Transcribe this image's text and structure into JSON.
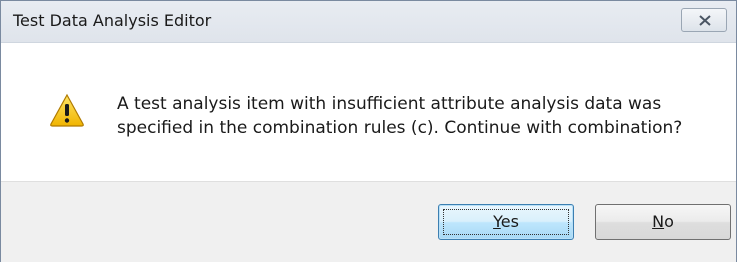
{
  "window": {
    "title": "Test Data Analysis Editor",
    "close_icon": "close-icon"
  },
  "message": {
    "icon": "warning-icon",
    "text": "A test analysis item with insufficient attribute analysis data was specified in the combination rules (c). Continue with combination?"
  },
  "buttons": {
    "yes": {
      "mnemonic": "Y",
      "rest": "es"
    },
    "no": {
      "mnemonic": "N",
      "rest": "o"
    }
  },
  "colors": {
    "warning_fill": "#f5c400",
    "default_button_border": "#3c7fb1"
  }
}
